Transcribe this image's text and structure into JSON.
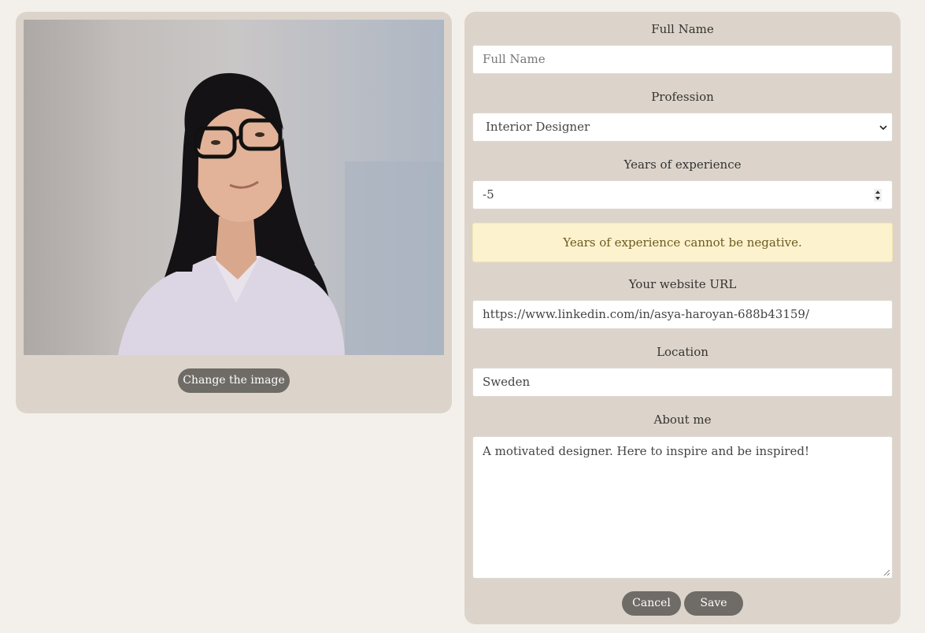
{
  "profile": {
    "change_image_label": "Change the image"
  },
  "form": {
    "full_name": {
      "label": "Full Name",
      "placeholder": "Full Name",
      "value": ""
    },
    "profession": {
      "label": "Profession",
      "value": "Interior Designer"
    },
    "years": {
      "label": "Years of experience",
      "value": "-5"
    },
    "error": "Years of experience cannot be negative.",
    "website": {
      "label": "Your website URL",
      "value": "https://www.linkedin.com/in/asya-haroyan-688b43159/"
    },
    "location": {
      "label": "Location",
      "value": "Sweden"
    },
    "about": {
      "label": "About me",
      "value": "A motivated designer. Here to inspire and be inspired!"
    },
    "cancel_label": "Cancel",
    "save_label": "Save"
  },
  "colors": {
    "page_bg": "#f3f0eb",
    "card_bg": "#dcd4ca",
    "button_bg": "#6f6b66",
    "alert_bg": "#fcf2cd",
    "alert_text": "#6d5a20"
  },
  "icons": [
    "select-chevron-icon",
    "number-spinner-icon",
    "resize-grip-icon"
  ]
}
